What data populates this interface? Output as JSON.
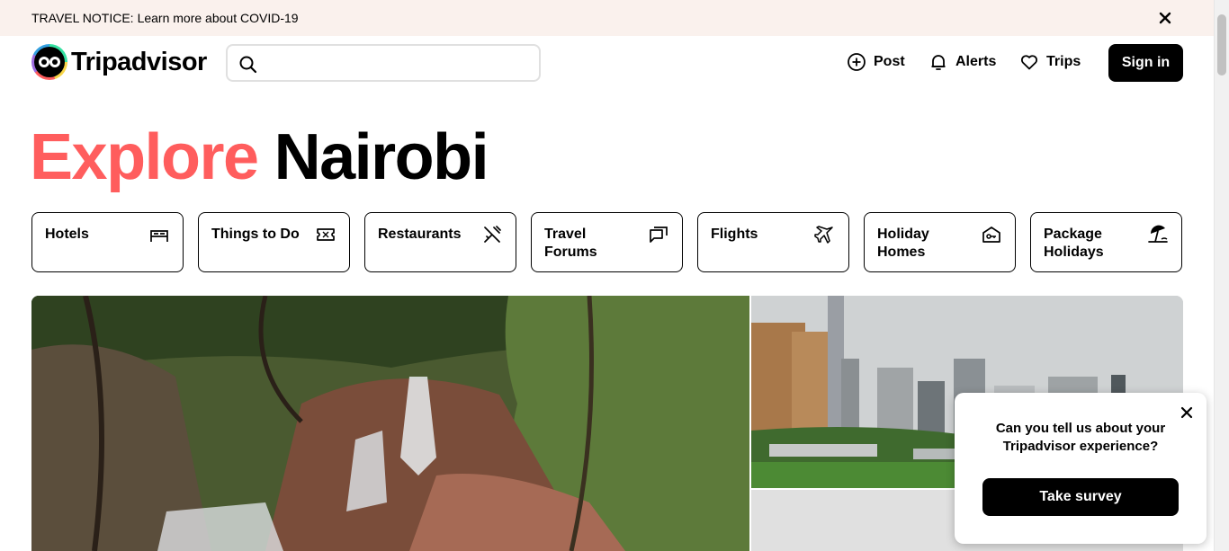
{
  "notice": {
    "lead": "TRAVEL NOTICE:",
    "link": "Learn more about COVID-19"
  },
  "header": {
    "logo_text": "Tripadvisor",
    "search_placeholder": "",
    "nav": [
      {
        "label": "Post",
        "icon": "plus-circle-icon"
      },
      {
        "label": "Alerts",
        "icon": "bell-icon"
      },
      {
        "label": "Trips",
        "icon": "heart-icon"
      }
    ],
    "signin": "Sign in"
  },
  "title": {
    "word1": "Explore",
    "word2": "Nairobi"
  },
  "categories": [
    {
      "label": "Hotels",
      "icon": "bed-icon"
    },
    {
      "label": "Things to Do",
      "icon": "ticket-icon"
    },
    {
      "label": "Restaurants",
      "icon": "fork-knife-icon"
    },
    {
      "label": "Travel Forums",
      "icon": "chat-bubbles-icon"
    },
    {
      "label": "Flights",
      "icon": "plane-icon"
    },
    {
      "label": "Holiday Homes",
      "icon": "house-key-icon"
    },
    {
      "label": "Package Holidays",
      "icon": "beach-umbrella-icon"
    }
  ],
  "survey": {
    "text": "Can you tell us about your Tripadvisor experience?",
    "button": "Take survey"
  },
  "colors": {
    "accent": "#ff5d5d",
    "notice_bg": "#faf1ed",
    "button_bg": "#000000"
  }
}
